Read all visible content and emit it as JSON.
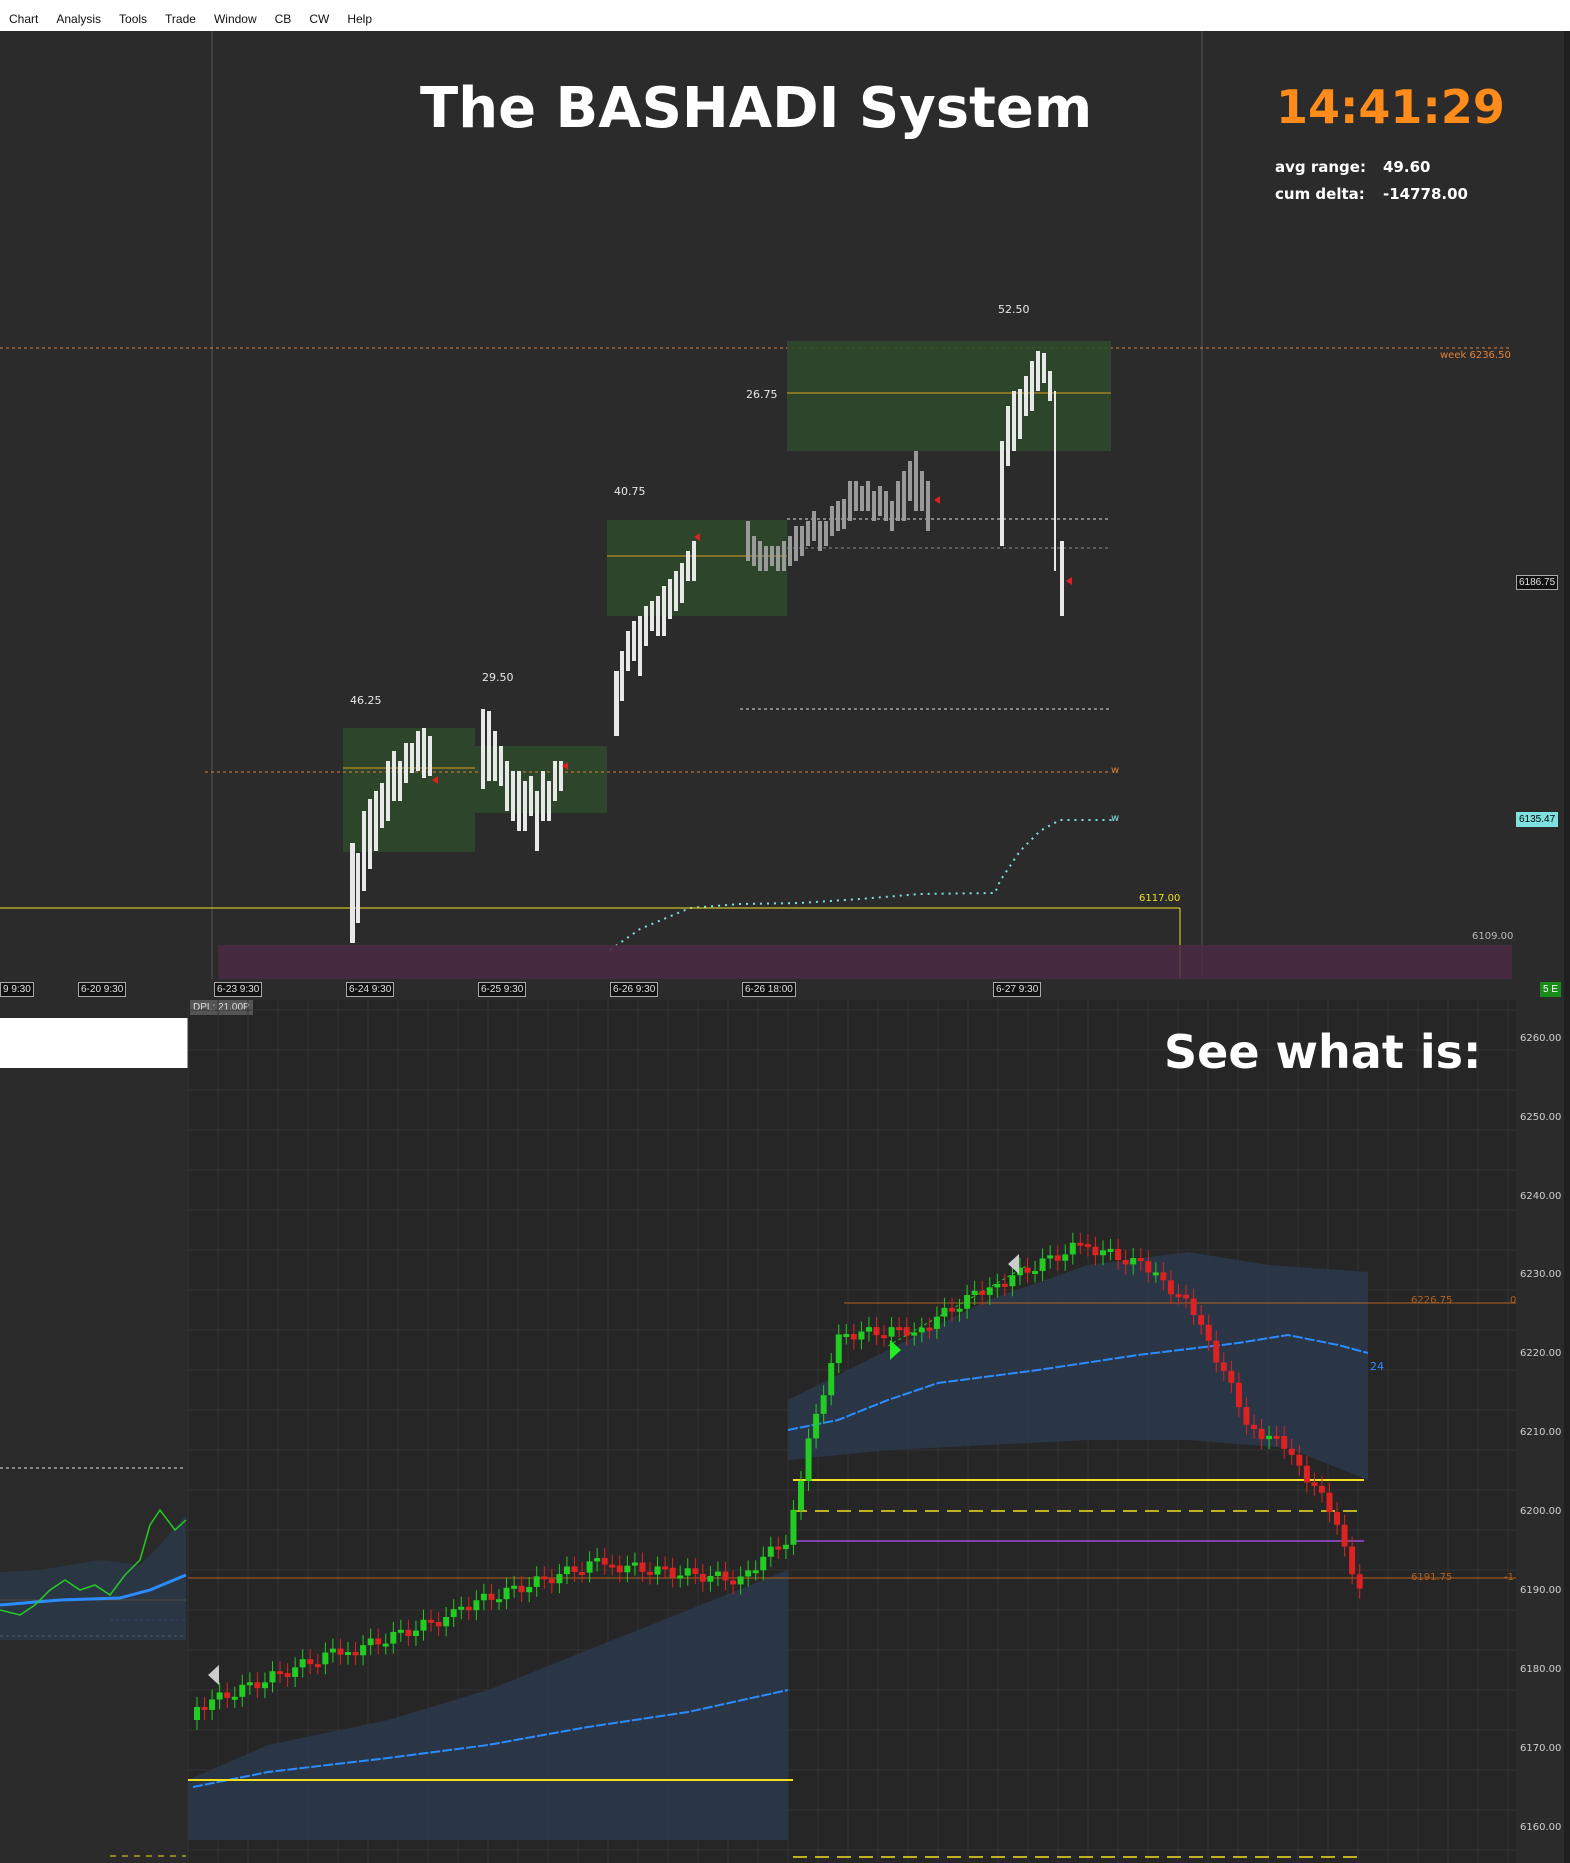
{
  "menu": [
    "Chart",
    "Analysis",
    "Tools",
    "Trade",
    "Window",
    "CB",
    "CW",
    "Help"
  ],
  "top_chart": {
    "title": "The BASHADI System",
    "clock": "14:41:29",
    "avg_range_label": "avg range:",
    "avg_range_value": "49.60",
    "cum_delta_label": "cum delta:",
    "cum_delta_value": "-14778.00",
    "profile_ranges": [
      "46.25",
      "29.50",
      "40.75",
      "26.75",
      "52.50"
    ],
    "week_level_label": "week",
    "week_level_value": "6236.50",
    "price_tag_1": "6186.75",
    "price_tag_2": "6135.47",
    "level_6117": "6117.00",
    "level_6109": "6109.00",
    "w_marker": "w",
    "time_labels": [
      "9 9:30",
      "6-20 9:30",
      "6-23 9:30",
      "6-24 9:30",
      "6-25 9:30",
      "6-26 9:30",
      "6-26 18:00",
      "6-27 9:30"
    ],
    "corner_badge": "5 E",
    "colors": {
      "clock": "#ff8c1a",
      "value_area": "#2e4a2a",
      "weekly_line": "#e0803a",
      "yellow": "#f0e020"
    }
  },
  "bottom_chart": {
    "title": "See what is:",
    "dpl_label": "DPL: 21.00P",
    "price_axis": [
      "6260.00",
      "6250.00",
      "6240.00",
      "6230.00",
      "6220.00",
      "6210.00",
      "6200.00",
      "6190.00",
      "6180.00",
      "6170.00",
      "6160.00"
    ],
    "level_6226": "6226.75",
    "level_6191": "6191.75",
    "tag_0": "0",
    "tag_neg1": "-1",
    "tag_24": "24",
    "colors": {
      "up": "#22cc22",
      "down": "#dd2222",
      "vwap": "#2a8cff",
      "band": "#2c3a4c",
      "yellow": "#f0e020",
      "purple": "#9b4dd6"
    }
  }
}
